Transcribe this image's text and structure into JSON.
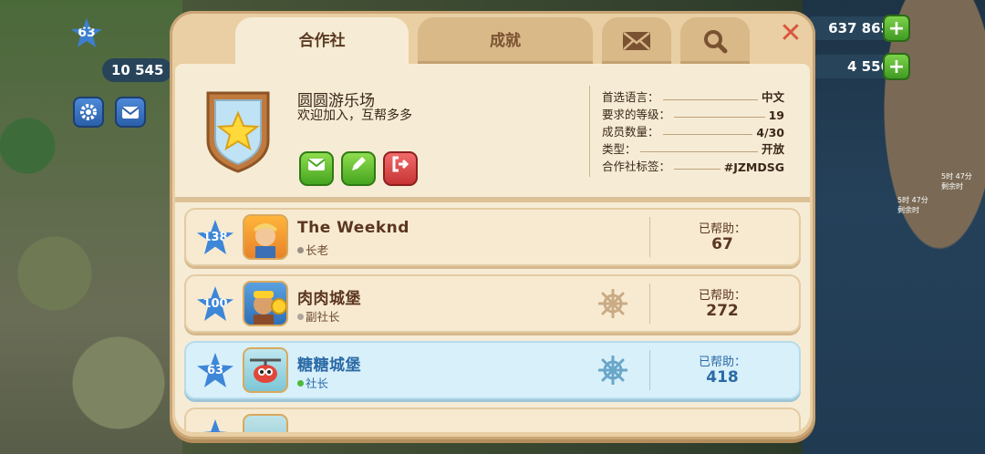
{
  "hud": {
    "player_level": "63",
    "coins_left": "10 545",
    "currency_1": "637 865",
    "currency_2": "4 556",
    "timer_1": "5时 47分",
    "timer_1_sub": "剩余时",
    "timer_2": "5时 47分",
    "timer_2_sub": "剩余时"
  },
  "tabs": [
    {
      "label": "合作社",
      "active": true
    },
    {
      "label": "成就",
      "active": false
    },
    {
      "icon": "mail-icon"
    },
    {
      "icon": "search-icon"
    }
  ],
  "club": {
    "name": "圆圆游乐场",
    "description": "欢迎加入，互帮多多",
    "info": [
      {
        "key": "首选语言：",
        "value": "中文"
      },
      {
        "key": "要求的等级：",
        "value": "19"
      },
      {
        "key": "成员数量：",
        "value": "4/30"
      },
      {
        "key": "类型：",
        "value": "开放"
      },
      {
        "key": "合作社标签：",
        "value": "#JZMDSG"
      }
    ]
  },
  "members": [
    {
      "level": "138",
      "name": "The Weeknd",
      "role": "长老",
      "help_label": "已帮助：",
      "helped": "67",
      "role_color": "#9a8f86"
    },
    {
      "level": "100",
      "name": "肉肉城堡",
      "role": "副社长",
      "help_label": "已帮助：",
      "helped": "272",
      "role_color": "#b0a59b"
    },
    {
      "level": "63",
      "name": "糖糖城堡",
      "role": "社长",
      "help_label": "已帮助：",
      "helped": "418",
      "role_color": "#4cbb3a",
      "is_me": true
    }
  ],
  "colors": {
    "panel_bg": "#e9cfa3",
    "card_bg": "#f7ead1",
    "highlight_bg": "#d8f0fa",
    "accent_green": "#45a51f",
    "accent_red": "#c63434",
    "close": "#d9573f"
  }
}
